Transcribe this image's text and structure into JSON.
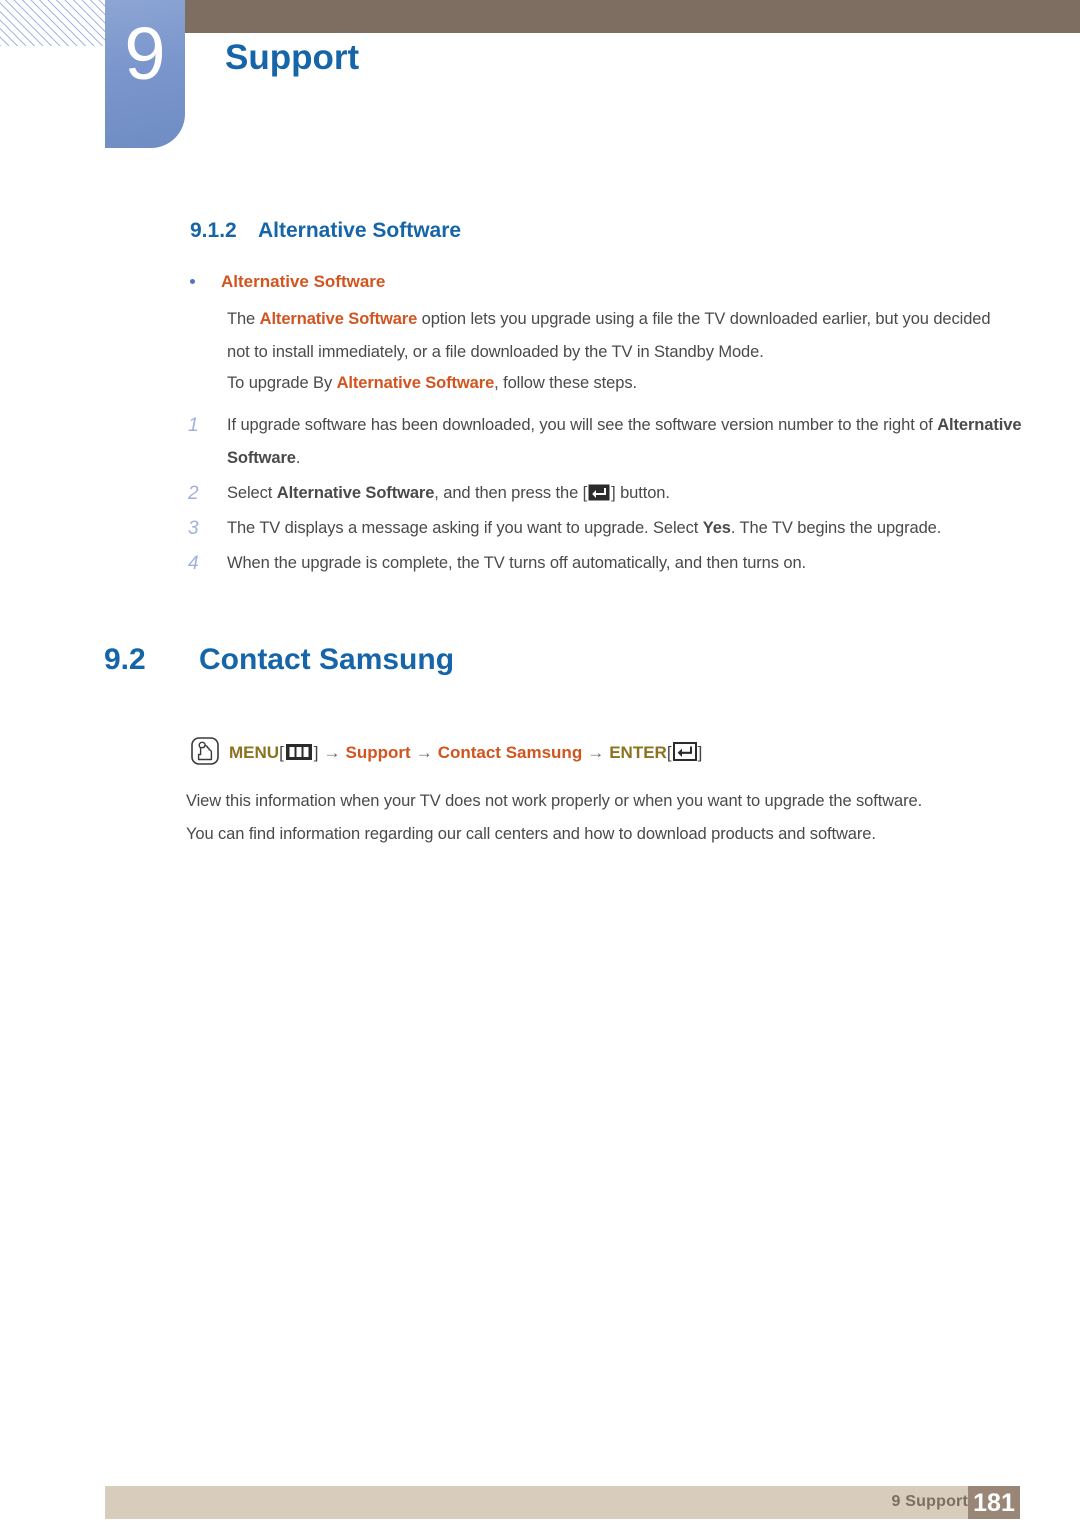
{
  "header": {
    "chapter_number": "9",
    "chapter_title": "Support"
  },
  "sections": {
    "subsection": {
      "number": "9.1.2",
      "title": "Alternative Software"
    },
    "section": {
      "number": "9.2",
      "title": "Contact Samsung"
    }
  },
  "bullet": {
    "heading": "Alternative Software"
  },
  "paragraphs": {
    "p1_a": "The ",
    "p1_kw": "Alternative Software",
    "p1_b": " option lets you upgrade using a file the TV downloaded earlier, but you decided not to install immediately, or a file downloaded by the TV in Standby Mode.",
    "p2_a": "To upgrade By ",
    "p2_kw": "Alternative Software",
    "p2_b": ", follow these steps.",
    "p3": "View this information when your TV does not work properly or when you want to upgrade the software.",
    "p4": "You can find information regarding our call centers and how to download products and software."
  },
  "steps": [
    {
      "number": "1",
      "text_a": "If upgrade software has been downloaded, you will see the software version number to the right of ",
      "keyword": "Alternative Software",
      "text_b": "."
    },
    {
      "number": "2",
      "text_a": "Select ",
      "keyword": "Alternative Software",
      "text_b": ", and then press the [",
      "text_c": "] button."
    },
    {
      "number": "3",
      "text_a": "The TV displays a message asking if you want to upgrade. Select ",
      "keyword": "Yes",
      "text_b": ". The TV begins the upgrade."
    },
    {
      "number": "4",
      "text_a": "When the upgrade is complete, the TV turns off automatically, and then turns on.",
      "keyword": "",
      "text_b": ""
    }
  ],
  "nav_path": {
    "menu_label": "MENU",
    "bracket_open": "[",
    "bracket_close": "]",
    "arrow": "→",
    "item1": "Support",
    "item2": "Contact Samsung",
    "enter_label": "ENTER"
  },
  "footer": {
    "label": "9 Support",
    "page": "181"
  },
  "colors": {
    "heading_blue": "#1565a8",
    "keyword_orange": "#d2541f",
    "menu_olive": "#8a7420",
    "header_brown": "#7d6e61",
    "tab_blue": "#7a96cc",
    "footer_beige": "#d8cdbc",
    "footer_page_brown": "#9a8677",
    "body_gray": "#4a4a4a",
    "step_number_blue": "#9fb0dd"
  }
}
